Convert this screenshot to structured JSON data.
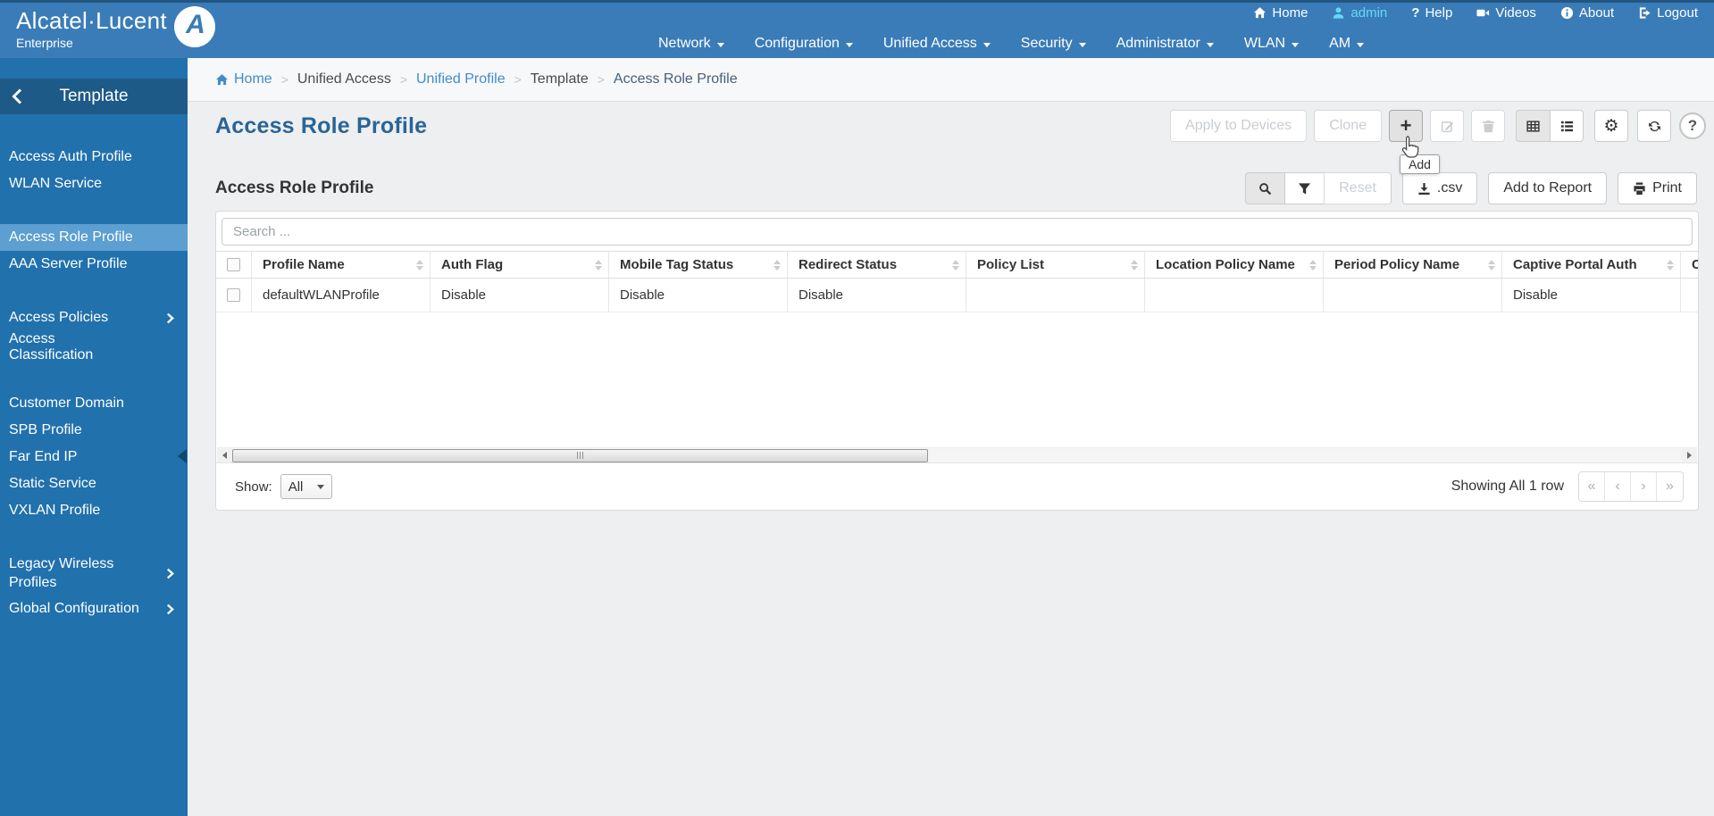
{
  "colors": {
    "header_blue": "#3a7cb8",
    "sidebar_blue": "#2171ad",
    "sidebar_header": "#1e5a87",
    "selected_item": "#5c9fd0",
    "link_blue": "#428bca",
    "title_blue": "#2a6496",
    "admin_cyan": "#64d9f7"
  },
  "logo": {
    "brand": "Alcatel·Lucent",
    "sub": "Enterprise",
    "mark": "A"
  },
  "topbar": {
    "items": [
      {
        "label": "Home",
        "icon": "home-icon"
      },
      {
        "label": "admin",
        "icon": "user-icon"
      },
      {
        "label": "Help",
        "icon": "question-icon",
        "glyph": "?"
      },
      {
        "label": "Videos",
        "icon": "video-icon"
      },
      {
        "label": "About",
        "icon": "info-icon"
      },
      {
        "label": "Logout",
        "icon": "logout-icon"
      }
    ]
  },
  "nav": {
    "items": [
      {
        "label": "Network"
      },
      {
        "label": "Configuration"
      },
      {
        "label": "Unified Access"
      },
      {
        "label": "Security"
      },
      {
        "label": "Administrator"
      },
      {
        "label": "WLAN"
      },
      {
        "label": "AM"
      }
    ]
  },
  "sidebar": {
    "title": "Template",
    "groups": [
      {
        "items": [
          {
            "label": "Access Auth Profile"
          },
          {
            "label": "WLAN Service"
          }
        ]
      },
      {
        "items": [
          {
            "label": "Access Role Profile",
            "selected": true
          },
          {
            "label": "AAA Server Profile"
          }
        ]
      },
      {
        "items": [
          {
            "label": "Access Policies",
            "expandable": true
          },
          {
            "label": "Access Classification"
          }
        ]
      },
      {
        "items": [
          {
            "label": "Customer Domain"
          },
          {
            "label": "SPB Profile"
          },
          {
            "label": "Far End IP"
          },
          {
            "label": "Static Service"
          },
          {
            "label": "VXLAN Profile"
          }
        ]
      },
      {
        "items": [
          {
            "label": "Legacy Wireless Profiles",
            "expandable": true
          },
          {
            "label": "Global Configuration",
            "expandable": true
          }
        ]
      }
    ]
  },
  "breadcrumb": {
    "separator": ">",
    "items": [
      {
        "label": "Home",
        "type": "link"
      },
      {
        "label": "Unified Access",
        "type": "text"
      },
      {
        "label": "Unified Profile",
        "type": "link"
      },
      {
        "label": "Template",
        "type": "text"
      },
      {
        "label": "Access Role Profile",
        "type": "current"
      }
    ]
  },
  "page": {
    "title": "Access Role Profile"
  },
  "toolbar": {
    "apply_label": "Apply to Devices",
    "clone_label": "Clone",
    "add_label": "+",
    "add_tooltip": "Add",
    "help_label": "?"
  },
  "section": {
    "title": "Access Role Profile",
    "reset_label": "Reset",
    "csv_label": ".csv",
    "add_to_report_label": "Add to Report",
    "print_label": "Print"
  },
  "search": {
    "placeholder": "Search ..."
  },
  "table": {
    "columns": [
      "Profile Name",
      "Auth Flag",
      "Mobile Tag Status",
      "Redirect Status",
      "Policy List",
      "Location Policy Name",
      "Period Policy Name",
      "Captive Portal Auth",
      "C"
    ],
    "rows": [
      {
        "cells": [
          "defaultWLANProfile",
          "Disable",
          "Disable",
          "Disable",
          "",
          "",
          "",
          "Disable",
          ""
        ]
      }
    ]
  },
  "footer": {
    "show_label": "Show:",
    "show_value": "All",
    "showing_text": "Showing All 1 row",
    "pager": [
      "«",
      "‹",
      "›",
      "»"
    ]
  }
}
